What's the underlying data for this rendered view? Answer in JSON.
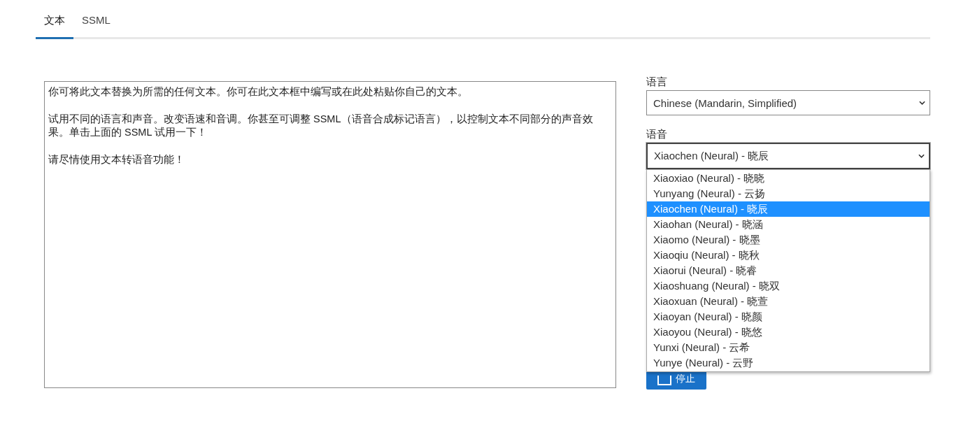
{
  "tabs": [
    {
      "label": "文本",
      "selected": true
    },
    {
      "label": "SSML",
      "selected": false
    }
  ],
  "text_input": {
    "paragraphs": [
      "你可将此文本替换为所需的任何文本。你可在此文本框中编写或在此处粘贴你自己的文本。",
      "试用不同的语言和声音。改变语速和音调。你甚至可调整 SSML（语音合成标记语言），以控制文本不同部分的声音效果。单击上面的 SSML 试用一下！",
      "请尽情使用文本转语音功能！"
    ]
  },
  "language": {
    "label": "语言",
    "value": "Chinese (Mandarin, Simplified)"
  },
  "voice": {
    "label": "语音",
    "value": "Xiaochen (Neural) - 晓辰",
    "open": true,
    "options": [
      {
        "label": "Xiaoxiao (Neural) - 晓晓",
        "selected": false
      },
      {
        "label": "Yunyang (Neural) - 云扬",
        "selected": false
      },
      {
        "label": "Xiaochen (Neural) - 晓辰",
        "selected": true
      },
      {
        "label": "Xiaohan (Neural) - 晓涵",
        "selected": false
      },
      {
        "label": "Xiaomo (Neural) - 晓墨",
        "selected": false
      },
      {
        "label": "Xiaoqiu (Neural) - 晓秋",
        "selected": false
      },
      {
        "label": "Xiaorui (Neural) - 晓睿",
        "selected": false
      },
      {
        "label": "Xiaoshuang (Neural) - 晓双",
        "selected": false
      },
      {
        "label": "Xiaoxuan (Neural) - 晓萱",
        "selected": false
      },
      {
        "label": "Xiaoyan (Neural) - 晓颜",
        "selected": false
      },
      {
        "label": "Xiaoyou (Neural) - 晓悠",
        "selected": false
      },
      {
        "label": "Yunxi (Neural) - 云希",
        "selected": false
      },
      {
        "label": "Yunye (Neural) - 云野",
        "selected": false
      }
    ]
  },
  "stop_button": {
    "label": "停止"
  }
}
